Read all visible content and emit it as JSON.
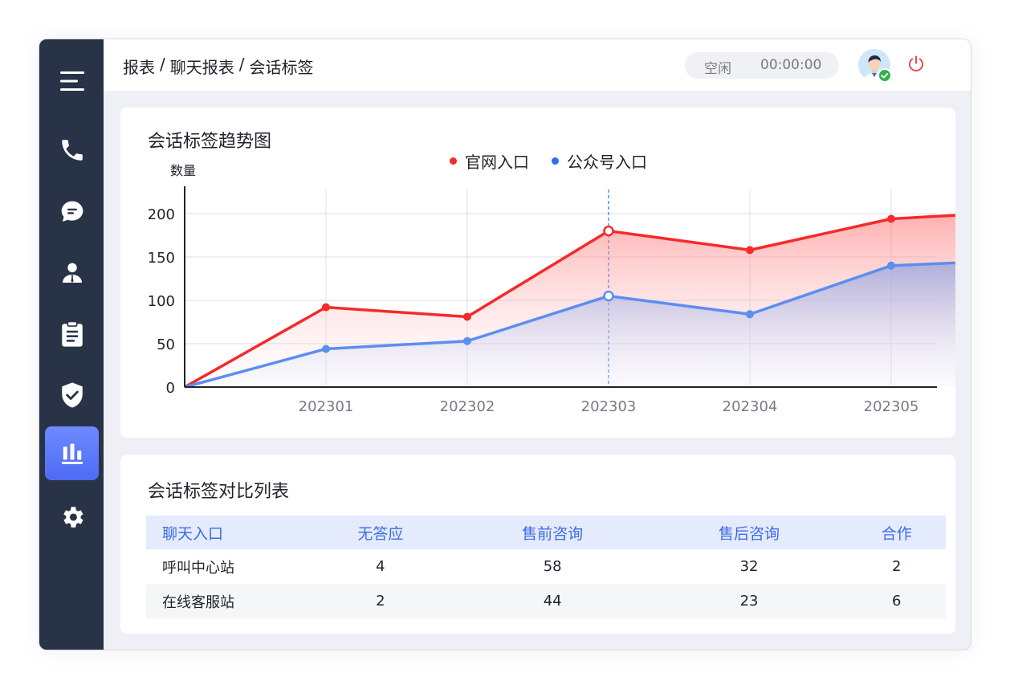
{
  "breadcrumb": [
    "报表",
    "聊天报表",
    "会话标签"
  ],
  "breadcrumb_separator": "/",
  "status": {
    "state": "空闲",
    "timer": "00:00:00"
  },
  "sidebar": {
    "items": [
      {
        "icon": "menu-icon"
      },
      {
        "icon": "phone-icon"
      },
      {
        "icon": "chat-icon"
      },
      {
        "icon": "user-icon"
      },
      {
        "icon": "clipboard-icon"
      },
      {
        "icon": "shield-icon"
      },
      {
        "icon": "bar-chart-icon",
        "active": true
      },
      {
        "icon": "gear-icon"
      }
    ]
  },
  "colors": {
    "accent": "#5b78f6",
    "series_red": "#f52a2a",
    "series_blue": "#5b8ef0",
    "sidebar": "#283347"
  },
  "chart_card": {
    "title": "会话标签趋势图"
  },
  "chart_data": {
    "type": "area",
    "ylabel": "数量",
    "ylim": [
      0,
      200
    ],
    "yticks": [
      "0",
      "50",
      "100",
      "150",
      "200"
    ],
    "x": [
      "",
      "202301",
      "202302",
      "202303",
      "202304",
      "202305",
      ""
    ],
    "categories": [
      "202301",
      "202302",
      "202303",
      "202304",
      "202305"
    ],
    "series": [
      {
        "name": "官网入口",
        "color": "#f52a2a",
        "values": [
          0,
          92,
          81,
          180,
          158,
          194,
          203
        ]
      },
      {
        "name": "公众号入口",
        "color": "#5b8ef0",
        "values": [
          0,
          44,
          53,
          105,
          84,
          140,
          147
        ]
      }
    ],
    "highlight_index": 3,
    "grid": true,
    "legend": "top-center"
  },
  "table_card": {
    "title": "会话标签对比列表",
    "columns": [
      "聊天入口",
      "无答应",
      "售前咨询",
      "售后咨询",
      "合作"
    ],
    "rows": [
      [
        "呼叫中心站",
        "4",
        "58",
        "32",
        "2"
      ],
      [
        "在线客服站",
        "2",
        "44",
        "23",
        "6"
      ]
    ]
  }
}
